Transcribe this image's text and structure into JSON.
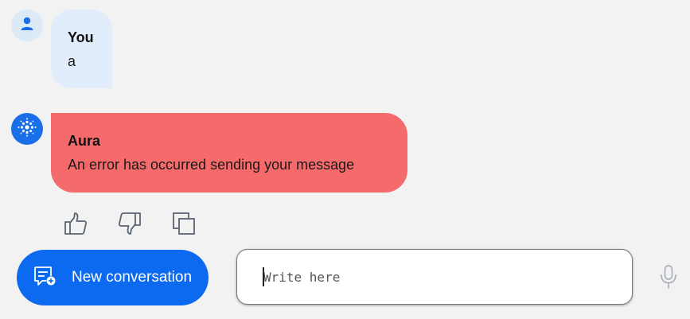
{
  "messages": [
    {
      "author": "You",
      "text": "a",
      "avatar_icon": "user-icon"
    },
    {
      "author": "Aura",
      "text": "An error has occurred sending your message",
      "avatar_icon": "aura-logo-icon",
      "status": "error"
    }
  ],
  "message_actions": [
    {
      "icon": "thumbs-up-icon"
    },
    {
      "icon": "thumbs-down-icon"
    },
    {
      "icon": "copy-icon"
    }
  ],
  "footer": {
    "new_conversation_label": "New conversation",
    "new_conversation_icon": "chat-add-icon",
    "input_placeholder": "Write here",
    "input_value": "",
    "mic_icon": "microphone-icon"
  },
  "colors": {
    "background": "#f2f2f2",
    "user_bubble": "#e2edfb",
    "error_bubble": "#f56b6b",
    "primary": "#0b6af0",
    "icon_gray": "#5b6473"
  }
}
